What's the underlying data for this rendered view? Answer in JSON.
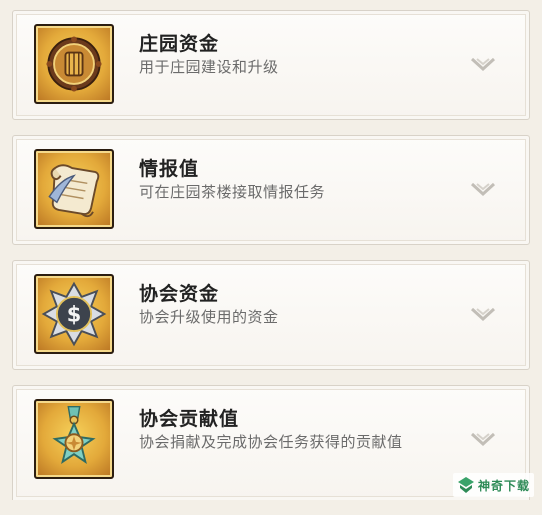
{
  "items": [
    {
      "icon": "manor-funds-coin-icon",
      "title": "庄园资金",
      "desc": "用于庄园建设和升级"
    },
    {
      "icon": "intel-scroll-icon",
      "title": "情报值",
      "desc": "可在庄园茶楼接取情报任务"
    },
    {
      "icon": "guild-funds-coin-icon",
      "title": "协会资金",
      "desc": "协会升级使用的资金"
    },
    {
      "icon": "contribution-medal-icon",
      "title": "协会贡献值",
      "desc": "协会捐献及完成协会任务获得的贡献值"
    }
  ],
  "watermark": {
    "text": "神奇下载"
  },
  "colors": {
    "icon_bg": "#e3a93a",
    "chevron": "#b9b5ae",
    "watermark": "#2e8b57"
  }
}
